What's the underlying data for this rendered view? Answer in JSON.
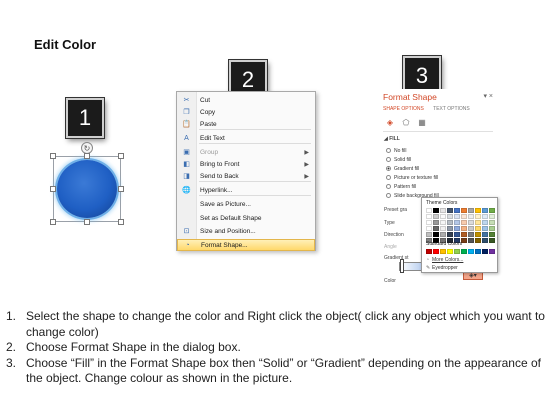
{
  "title": "Edit Color",
  "badges": [
    "1",
    "2",
    "3"
  ],
  "context_menu": {
    "items": [
      {
        "label": "Cut",
        "icon": "scissors-icon",
        "glyph": "✂"
      },
      {
        "label": "Copy",
        "icon": "copy-icon",
        "glyph": "❐"
      },
      {
        "label": "Paste",
        "icon": "paste-icon",
        "glyph": "📋"
      },
      {
        "label": "Edit Text",
        "icon": "edit-text-icon",
        "glyph": "A"
      },
      {
        "label": "Group",
        "icon": "group-icon",
        "glyph": "▣",
        "disabled": true,
        "submenu": true
      },
      {
        "label": "Bring to Front",
        "icon": "bring-front-icon",
        "glyph": "◧",
        "submenu": true
      },
      {
        "label": "Send to Back",
        "icon": "send-back-icon",
        "glyph": "◨",
        "submenu": true
      },
      {
        "label": "Hyperlink...",
        "icon": "hyperlink-icon",
        "glyph": "🌐"
      },
      {
        "label": "Save as Picture...",
        "icon": "",
        "glyph": ""
      },
      {
        "label": "Set as Default Shape",
        "icon": "",
        "glyph": ""
      },
      {
        "label": "Size and Position...",
        "icon": "size-position-icon",
        "glyph": "⊡"
      },
      {
        "label": "Format Shape...",
        "icon": "format-shape-icon",
        "glyph": "◔",
        "highlighted": true
      }
    ]
  },
  "format_pane": {
    "title": "Format Shape",
    "close": "▾ ×",
    "tabs": [
      "SHAPE OPTIONS",
      "TEXT OPTIONS"
    ],
    "fill_header": "◢ FILL",
    "fill_options": [
      "No fill",
      "Solid fill",
      "Gradient fill",
      "Picture or texture fill",
      "Pattern fill",
      "Slide background fill"
    ],
    "selected_fill": "Gradient fill",
    "labels": [
      "Preset gra",
      "Type",
      "Direction",
      "Angle",
      "Gradient st",
      "Color"
    ],
    "color_dropdown": {
      "theme_header": "Theme Colors",
      "standard_header": "Standard Colors",
      "more_colors": "More Colors...",
      "eyedropper": "Eyedropper",
      "theme_row": [
        "#ffffff",
        "#000000",
        "#e7e6e6",
        "#44546a",
        "#4472c4",
        "#ed7d31",
        "#a5a5a5",
        "#ffc000",
        "#5b9bd5",
        "#70ad47"
      ],
      "standard_row": [
        "#c00000",
        "#ff0000",
        "#ffc000",
        "#ffff00",
        "#92d050",
        "#00b050",
        "#00b0f0",
        "#0070c0",
        "#002060",
        "#7030a0"
      ]
    }
  },
  "instructions": [
    {
      "num": "1.",
      "text": "Select the shape to change the color and Right click the object( click any object which you want to change color)"
    },
    {
      "num": "2.",
      "text": "Choose Format Shape in the dialog box."
    },
    {
      "num": "3.",
      "text": "Choose “Fill” in the Format Shape box then “Solid” or “Gradient” depending on the appearance of the object. Change colour as shown in the picture."
    }
  ]
}
